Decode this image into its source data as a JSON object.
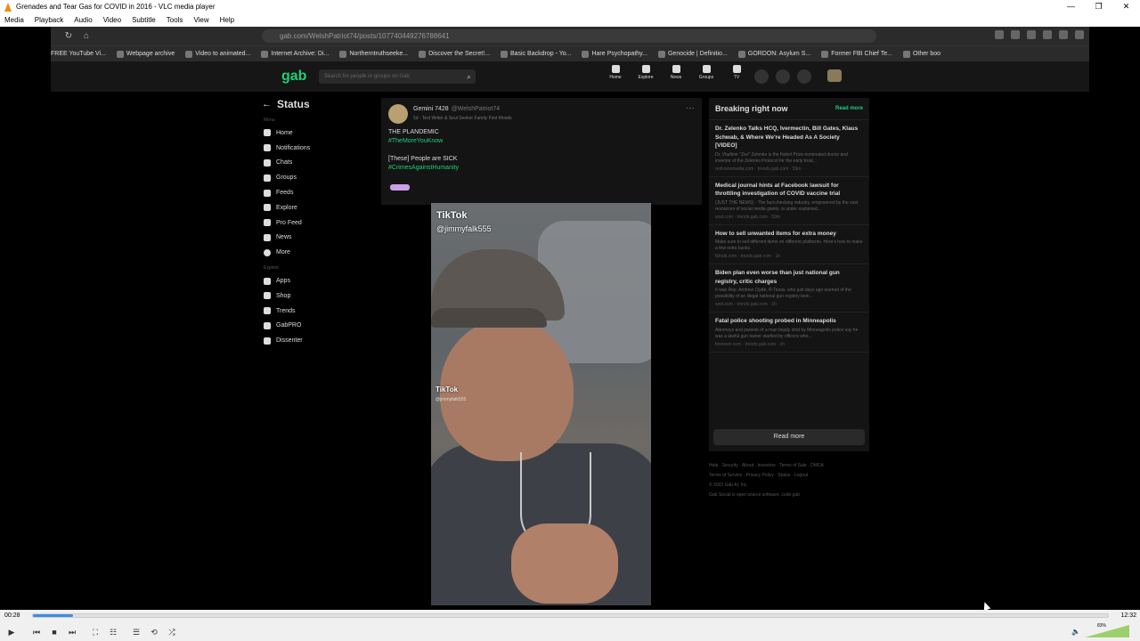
{
  "window": {
    "title": "Grenades and Tear Gas for COVID in 2016 - VLC media player",
    "controls": [
      "—",
      "❐",
      "✕"
    ]
  },
  "menu": [
    "Media",
    "Playback",
    "Audio",
    "Video",
    "Subtitle",
    "Tools",
    "View",
    "Help"
  ],
  "browser": {
    "url": "gab.com/WelshPatriot74/posts/107740449276788641",
    "bookmarks": [
      "FREE YouTube Vi...",
      "Webpage archive",
      "Video to animated...",
      "Internet Archive: Di...",
      "Northerntruthseeke...",
      "Discover the Secret!...",
      "Basic Backdrop - Yo...",
      "Hare Psychopathy...",
      "Genocide | Definitio...",
      "GORDON: Asylum S...",
      "Former FBI Chief Te...",
      "Other boo"
    ]
  },
  "gab": {
    "logo": "gab",
    "search_placeholder": "Search for people or groups on Gab",
    "nav": [
      "Home",
      "Explore",
      "News",
      "Groups",
      "TV"
    ]
  },
  "sidebar": {
    "title": "Status",
    "menu_label": "Menu",
    "items": [
      "Home",
      "Notifications",
      "Chats",
      "Groups",
      "Feeds",
      "Explore",
      "Pro Feed",
      "News",
      "More"
    ],
    "explore_label": "Explore",
    "explore_items": [
      "Apps",
      "Shop",
      "Trends",
      "GabPRO",
      "Dissenter"
    ]
  },
  "post": {
    "username": "Gemini 7428",
    "handle": "@WelshPatriot74",
    "subline": "5d · Text Writer & Soul Seeker Family First Moods",
    "line1": "THE PLANDEMIC",
    "tag1": "#TheMoreYouKnow",
    "line2": "[These] People are SICK",
    "tag2": "#CrimesAgainstHumanity"
  },
  "video_overlay": {
    "logo": "TikTok",
    "user": "@jimmyfalk555",
    "logo2": "TikTok",
    "user2": "@jimmyfalk555"
  },
  "breaking": {
    "title": "Breaking right now",
    "read_more_link": "Read more",
    "items": [
      {
        "title": "Dr. Zelenko Talks HCQ, Ivermectin, Bill Gates, Klaus Schwab, & Where We're Headed As A Society [VIDEO]",
        "desc": "Dr. Vladimir \"Zev\" Zelenko is the Nobel Prize-nominated doctor and inventor of the Zelenko Protocol for the early treat...",
        "meta": "redvoicemedia.com · trends.gab.com · 59m"
      },
      {
        "title": "Medical journal hints at Facebook lawsuit for throttling investigation of COVID vaccine trial",
        "desc": "(JUST THE NEWS) - The fact-checking industry, empowered by the vast resources of social media giants, is under sustained...",
        "meta": "wnd.com · trends.gab.com · 59m"
      },
      {
        "title": "How to sell unwanted items for extra money",
        "desc": "Make sure to sell different items on different platforms. Here's how to make a few extra bucks.",
        "meta": "fahsbl.com · trends.gab.com · 1h"
      },
      {
        "title": "Biden plan even worse than just national gun registry, critic charges",
        "desc": "It was Rep. Andrew Clyde, R-Texas, who just days ago warned of the possibility of an illegal national gun registry bein...",
        "meta": "wnd.com · trends.gab.com · 1h"
      },
      {
        "title": "Fatal police shooting probed in Minneapolis",
        "desc": "Attorneys and parents of a man fatally shot by Minneapolis police say he was a lawful gun owner startled by officers who...",
        "meta": "foxnews.com · trends.gab.com · 1h"
      }
    ],
    "read_more_button": "Read more"
  },
  "footer": {
    "line1": "Help · Security · About · Investors · Terms of Sale · DMCA",
    "line2": "Terms of Service · Privacy Policy · Status · Logout",
    "line3": "© 2022 Gab AI, Inc.",
    "line4": "Gab Social is open source software. code.gab"
  },
  "player": {
    "current_time": "00:28",
    "total_time": "12:32",
    "progress": 0.037,
    "volume": "83%",
    "volume_level": 0.83
  }
}
